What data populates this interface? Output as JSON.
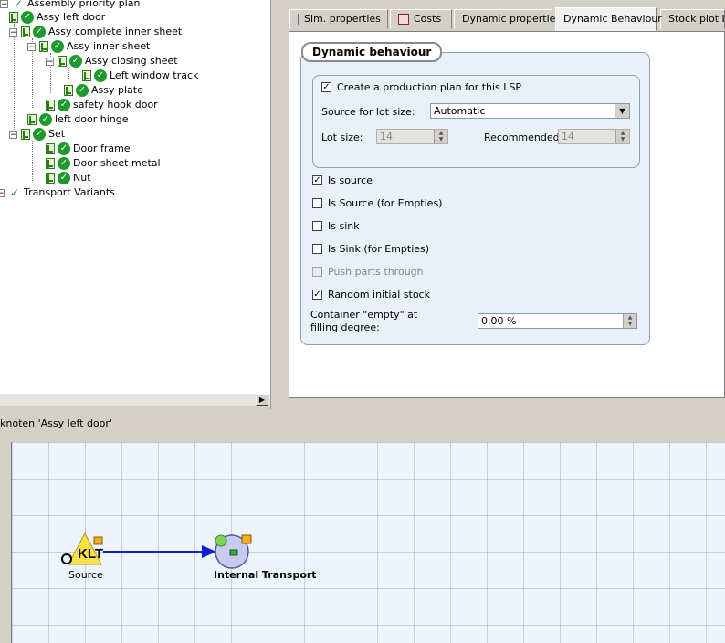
{
  "tree": {
    "items": [
      {
        "label": "Assembly priority plan",
        "icon": "check-icon"
      },
      {
        "label": "Assy left door",
        "icon": "done-circle-icon"
      },
      {
        "label": "Assy complete inner sheet",
        "icon": "done-circle-icon"
      },
      {
        "label": "Assy inner sheet",
        "icon": "done-circle-icon"
      },
      {
        "label": "Assy closing sheet",
        "icon": "done-circle-icon"
      },
      {
        "label": "Left window track",
        "icon": "done-circle-icon"
      },
      {
        "label": "Assy plate",
        "icon": "done-circle-icon"
      },
      {
        "label": "safety hook door",
        "icon": "done-circle-icon"
      },
      {
        "label": "left door hinge",
        "icon": "done-circle-icon"
      },
      {
        "label": "Set",
        "icon": "done-circle-icon"
      },
      {
        "label": "Door frame",
        "icon": "done-circle-icon"
      },
      {
        "label": "Door sheet metal",
        "icon": "done-circle-icon"
      },
      {
        "label": "Nut",
        "icon": "done-circle-icon"
      },
      {
        "label": "Transport Variants",
        "icon": "check-icon"
      }
    ]
  },
  "tabs": [
    {
      "label": "Sim. properties",
      "icon": "sim-properties-icon"
    },
    {
      "label": "Costs",
      "icon": "costs-icon"
    },
    {
      "label": "Dynamic properties"
    },
    {
      "label": "Dynamic Behaviour",
      "active": true
    },
    {
      "label": "Stock plot LS"
    }
  ],
  "dynamic": {
    "title": "Dynamic behaviour",
    "production_plan": {
      "label": "Create a production plan for this LSP",
      "checked": true,
      "source_lot_label": "Source for lot size:",
      "source_lot_value": "Automatic",
      "lot_size_label": "Lot size:",
      "lot_size_value": "14",
      "recommended_label": "Recommended:",
      "recommended_value": "14"
    },
    "options": [
      {
        "label": "Is source",
        "checked": true,
        "enabled": true
      },
      {
        "label": "Is Source (for Empties)",
        "checked": false,
        "enabled": true
      },
      {
        "label": "Is sink",
        "checked": false,
        "enabled": true
      },
      {
        "label": "Is Sink (for Empties)",
        "checked": false,
        "enabled": true
      },
      {
        "label": "Push parts through",
        "checked": false,
        "enabled": false
      },
      {
        "label": "Random initial stock",
        "checked": true,
        "enabled": true
      }
    ],
    "container_label_1": "Container \"empty\" at",
    "container_label_2": "filling degree:",
    "container_value": "0,00 %"
  },
  "status": {
    "text": "knoten 'Assy left door'"
  },
  "canvas": {
    "source_label": "Source",
    "transport_label": "Internal Transport",
    "source_badge": "KLT"
  },
  "colors": {
    "check_green": "#1e9a2c",
    "arrow_blue": "#0a1fd4",
    "group_fill": "#e9f0f8"
  }
}
